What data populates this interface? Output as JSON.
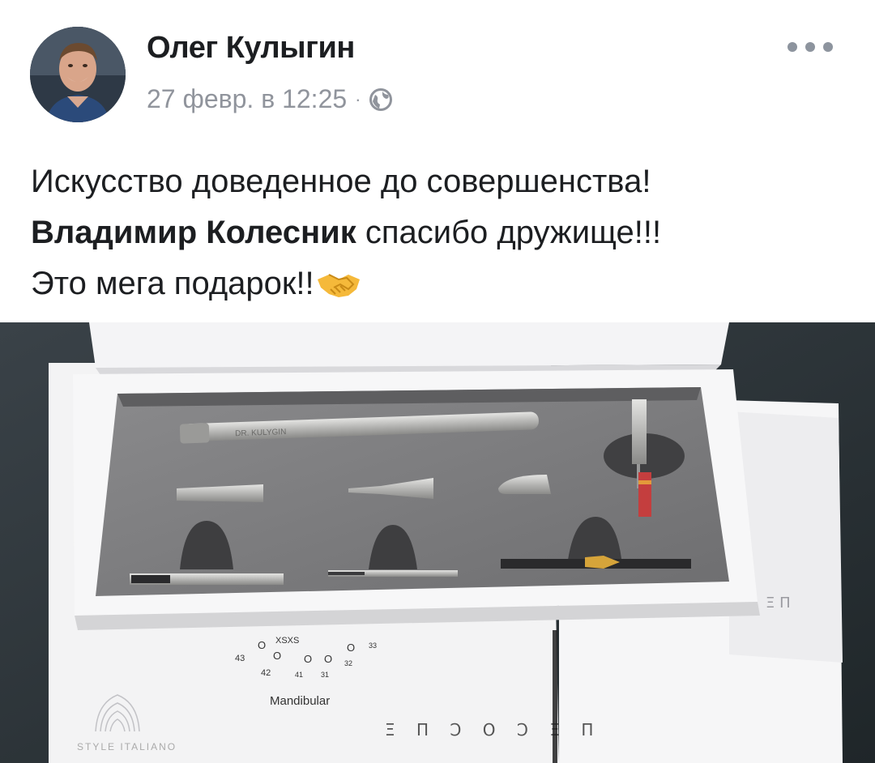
{
  "post": {
    "author": "Олег Кулыгин",
    "timestamp": "27 февр. в 12:25",
    "separator": "·",
    "privacy_icon": "globe-icon",
    "more_icon": "more-options-icon",
    "text": {
      "line1": "Искусство доведенное до совершенства!",
      "mention": "Владимир Колесник",
      "line2_rest": " спасибо дружище!!!",
      "line3": "Это мега подарок!!",
      "emoji": "handshake-icon"
    }
  },
  "photo": {
    "engraving": "DR. KULYGIN",
    "chart_numbers_row1": [
      "43",
      "42",
      "41",
      "31",
      "32",
      "33"
    ],
    "label_mandibular": "Mandibular",
    "brand_endopen": "Ξ Π Ͻ Ο Ͻ Ξ Π",
    "brand_small": "Ξ Π",
    "brand_italiano": "STYLE ITALIANO"
  },
  "colors": {
    "text_primary": "#1c1e21",
    "text_secondary": "#90949c",
    "foam": "#7d7d7f",
    "box_white": "#f0f0f2",
    "background_dark": "#2c3338"
  }
}
